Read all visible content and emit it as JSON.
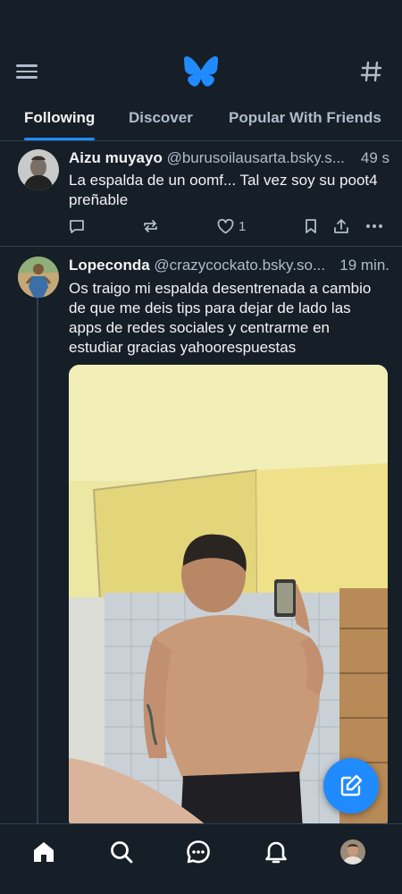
{
  "header": {
    "menu_icon": "hamburger-menu-icon",
    "logo": "butterfly-logo",
    "feeds_icon": "hashtag-icon",
    "brand_color": "#208bfe"
  },
  "tabs": [
    {
      "label": "Following",
      "active": true
    },
    {
      "label": "Discover",
      "active": false
    },
    {
      "label": "Popular With Friends",
      "active": false
    }
  ],
  "posts": [
    {
      "author": "Aizu muyayo",
      "handle": "@burusoilausarta.bsky.s...",
      "time": "49 s",
      "text": "La espalda de un oomf... Tal vez soy su poot4 preñable",
      "likes": "1"
    },
    {
      "author": "Lopeconda",
      "handle": "@crazycockato.bsky.so...",
      "time": "19 min.",
      "text": "Os traigo mi espalda desentrenada a cambio de que me deis tips para dejar de lado las apps de redes sociales y centrarme en estudiar gracias yahoorespuestas",
      "has_image": true
    }
  ],
  "fab": {
    "icon": "compose-icon"
  },
  "bottom_nav": [
    {
      "icon": "home-icon",
      "active": true
    },
    {
      "icon": "search-icon"
    },
    {
      "icon": "chat-icon"
    },
    {
      "icon": "bell-icon"
    },
    {
      "icon": "profile-avatar"
    }
  ],
  "colors": {
    "background": "#161e27",
    "border": "#2e4052",
    "text_secondary": "#aebbc9",
    "accent": "#208bfe"
  }
}
